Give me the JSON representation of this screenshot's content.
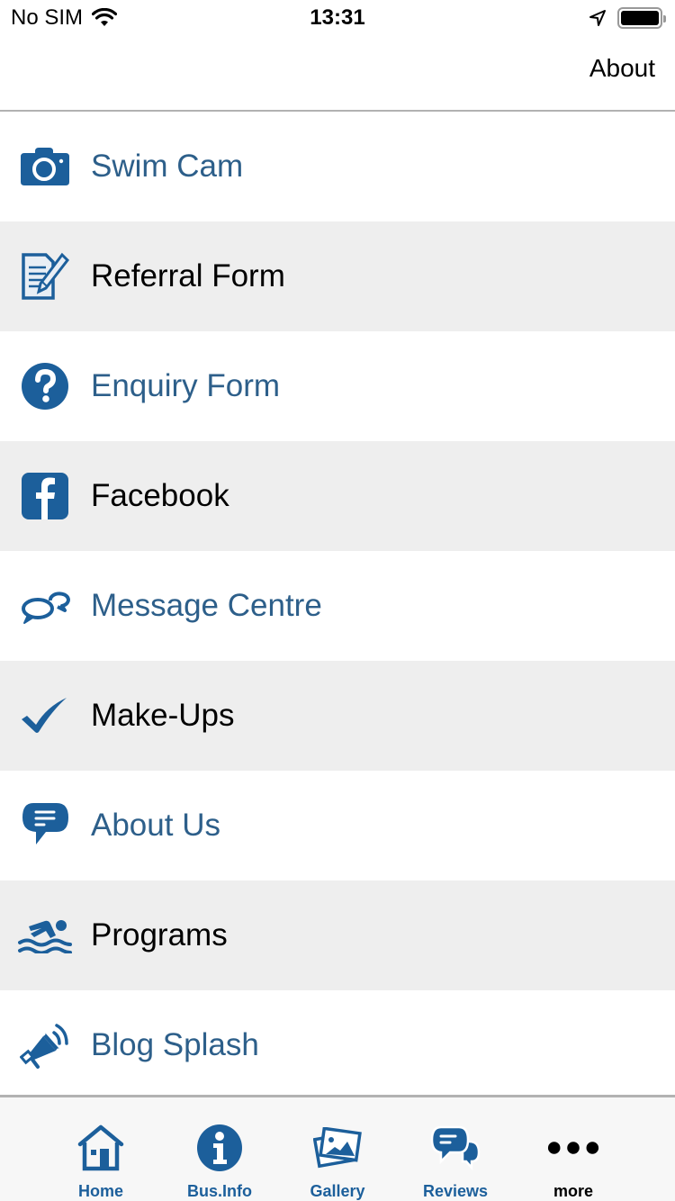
{
  "status_bar": {
    "carrier": "No SIM",
    "time": "13:31",
    "wifi_icon": "wifi-icon",
    "location_icon": "location-arrow-icon",
    "battery_icon": "battery-icon"
  },
  "nav": {
    "right_button": "About"
  },
  "colors": {
    "accent": "#1c5f9b",
    "label_blue": "#2d5f8a",
    "alt_row": "#eeeeee"
  },
  "menu": {
    "items": [
      {
        "label": "Swim Cam",
        "icon": "camera-icon"
      },
      {
        "label": "Referral Form",
        "icon": "form-edit-icon"
      },
      {
        "label": "Enquiry Form",
        "icon": "question-circle-icon"
      },
      {
        "label": "Facebook",
        "icon": "facebook-icon"
      },
      {
        "label": "Message Centre",
        "icon": "chat-bubbles-icon"
      },
      {
        "label": "Make-Ups",
        "icon": "checkmark-icon"
      },
      {
        "label": "About Us",
        "icon": "speech-bubble-icon"
      },
      {
        "label": "Programs",
        "icon": "swimmer-icon"
      },
      {
        "label": "Blog Splash",
        "icon": "megaphone-icon"
      }
    ]
  },
  "tabs": [
    {
      "label": "Home",
      "icon": "home-icon"
    },
    {
      "label": "Bus.Info",
      "icon": "info-icon"
    },
    {
      "label": "Gallery",
      "icon": "gallery-icon"
    },
    {
      "label": "Reviews",
      "icon": "reviews-icon"
    },
    {
      "label": "more",
      "icon": "more-dots-icon"
    }
  ]
}
